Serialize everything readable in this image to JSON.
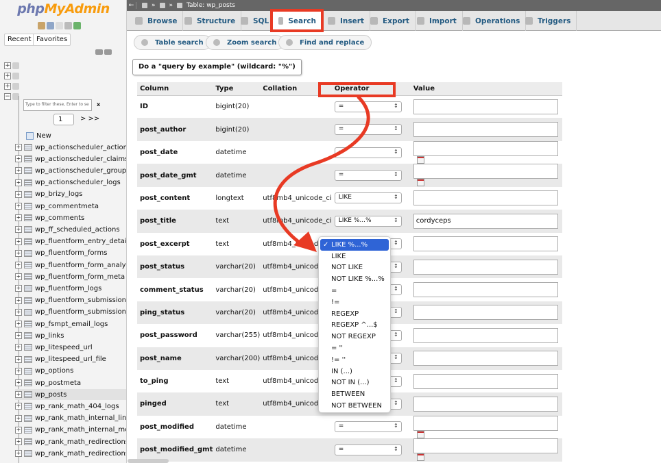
{
  "nav": {
    "logo_php": "php",
    "logo_my": "MyAdmin",
    "recent_label": "Recent",
    "favorites_label": "Favorites",
    "filter_placeholder": "Type to filter these, Enter to se",
    "filter_clear": "x",
    "page_value": "1",
    "page_next": "> >>",
    "new_label": "New",
    "tables": [
      "wp_actionscheduler_actions",
      "wp_actionscheduler_claims",
      "wp_actionscheduler_groups",
      "wp_actionscheduler_logs",
      "wp_brizy_logs",
      "wp_commentmeta",
      "wp_comments",
      "wp_ff_scheduled_actions",
      "wp_fluentform_entry_details",
      "wp_fluentform_forms",
      "wp_fluentform_form_analytics",
      "wp_fluentform_form_meta",
      "wp_fluentform_logs",
      "wp_fluentform_submissions",
      "wp_fluentform_submission_m",
      "wp_fsmpt_email_logs",
      "wp_links",
      "wp_litespeed_url",
      "wp_litespeed_url_file",
      "wp_options",
      "wp_postmeta",
      "wp_posts",
      "wp_rank_math_404_logs",
      "wp_rank_math_internal_links",
      "wp_rank_math_internal_meta",
      "wp_rank_math_redirections",
      "wp_rank_math_redirections_c"
    ],
    "active_table": "wp_posts"
  },
  "topbar": {
    "breadcrumb": "Table: wp_posts"
  },
  "tabs": {
    "browse": "Browse",
    "structure": "Structure",
    "sql": "SQL",
    "search": "Search",
    "insert": "Insert",
    "export": "Export",
    "import": "Import",
    "operations": "Operations",
    "triggers": "Triggers"
  },
  "subtabs": {
    "table_search": "Table search",
    "zoom_search": "Zoom search",
    "find_replace": "Find and replace"
  },
  "tooltip": "Do a \"query by example\" (wildcard: \"%\")",
  "table": {
    "headers": {
      "column": "Column",
      "type": "Type",
      "collation": "Collation",
      "operator": "Operator",
      "value": "Value"
    },
    "rows": [
      {
        "column": "ID",
        "type": "bigint(20)",
        "collation": "",
        "operator": "=",
        "value": "",
        "cal": false
      },
      {
        "column": "post_author",
        "type": "bigint(20)",
        "collation": "",
        "operator": "=",
        "value": "",
        "cal": false
      },
      {
        "column": "post_date",
        "type": "datetime",
        "collation": "",
        "operator": "=",
        "value": "",
        "cal": true
      },
      {
        "column": "post_date_gmt",
        "type": "datetime",
        "collation": "",
        "operator": "=",
        "value": "",
        "cal": true
      },
      {
        "column": "post_content",
        "type": "longtext",
        "collation": "utf8mb4_unicode_ci",
        "operator": "LIKE",
        "value": "",
        "cal": false
      },
      {
        "column": "post_title",
        "type": "text",
        "collation": "utf8mb4_unicode_ci",
        "operator": "LIKE %...%",
        "value": "cordyceps",
        "cal": false
      },
      {
        "column": "post_excerpt",
        "type": "text",
        "collation": "utf8mb4_unicode_ci",
        "operator": "",
        "value": "",
        "cal": false
      },
      {
        "column": "post_status",
        "type": "varchar(20)",
        "collation": "utf8mb4_unicode_ci",
        "operator": "",
        "value": "",
        "cal": false
      },
      {
        "column": "comment_status",
        "type": "varchar(20)",
        "collation": "utf8mb4_unicode_ci",
        "operator": "",
        "value": "",
        "cal": false
      },
      {
        "column": "ping_status",
        "type": "varchar(20)",
        "collation": "utf8mb4_unicode_ci",
        "operator": "",
        "value": "",
        "cal": false
      },
      {
        "column": "post_password",
        "type": "varchar(255)",
        "collation": "utf8mb4_unicode_ci",
        "operator": "",
        "value": "",
        "cal": false
      },
      {
        "column": "post_name",
        "type": "varchar(200)",
        "collation": "utf8mb4_unicode_ci",
        "operator": "",
        "value": "",
        "cal": false
      },
      {
        "column": "to_ping",
        "type": "text",
        "collation": "utf8mb4_unicode_ci",
        "operator": "",
        "value": "",
        "cal": false
      },
      {
        "column": "pinged",
        "type": "text",
        "collation": "utf8mb4_unicode_ci",
        "operator": "",
        "value": "",
        "cal": false
      },
      {
        "column": "post_modified",
        "type": "datetime",
        "collation": "",
        "operator": "=",
        "value": "",
        "cal": true
      },
      {
        "column": "post_modified_gmt",
        "type": "datetime",
        "collation": "",
        "operator": "=",
        "value": "",
        "cal": true
      }
    ]
  },
  "dropdown": {
    "selected": "LIKE %...%",
    "options": [
      "LIKE %...%",
      "LIKE",
      "NOT LIKE",
      "NOT LIKE %...%",
      "=",
      "!=",
      "REGEXP",
      "REGEXP ^...$",
      "NOT REGEXP",
      "= ''",
      "!= ''",
      "IN (...)",
      "NOT IN (...)",
      "BETWEEN",
      "NOT BETWEEN"
    ]
  },
  "colors": {
    "highlight": "#e83a24",
    "link": "#235a81",
    "selected_option": "#2f64d6"
  }
}
